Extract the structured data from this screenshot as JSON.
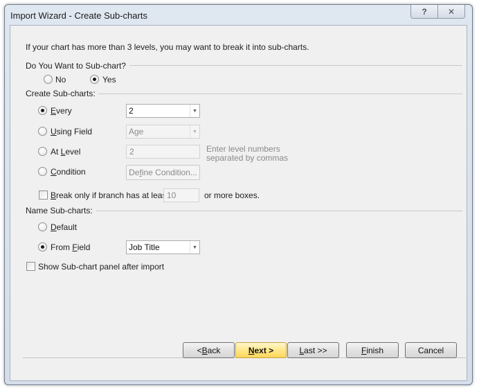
{
  "window": {
    "title": "Import Wizard - Create Sub-charts",
    "help_glyph": "?",
    "close_glyph": "✕"
  },
  "intro": "If your chart has more than 3 levels, you may want to break it into sub-charts.",
  "subchart_question": {
    "label": "Do You Want to Sub-chart?",
    "options": [
      {
        "label": "No",
        "checked": false
      },
      {
        "label": "Yes",
        "checked": true
      }
    ]
  },
  "create_subcharts": {
    "label": "Create Sub-charts:",
    "every": {
      "label": "Every",
      "accel": "E",
      "rest": "very",
      "checked": true,
      "value": "2"
    },
    "using_field": {
      "label": "Using Field",
      "accel": "U",
      "rest": "sing Field",
      "checked": false,
      "value": "Age"
    },
    "at_level": {
      "label": "At Level",
      "pre": "At ",
      "accel": "L",
      "rest": "evel",
      "checked": false,
      "value": "2",
      "hint_line1": "Enter level numbers",
      "hint_line2": "separated by commas"
    },
    "condition": {
      "label": "Condition",
      "accel": "C",
      "rest": "ondition",
      "checked": false,
      "button_label": "Define Condition...",
      "button_pre": "De",
      "button_accel": "f",
      "button_rest": "ine Condition..."
    },
    "break_only": {
      "label": "Break only if branch has at least",
      "accel": "B",
      "rest": "reak only if branch has at least",
      "checked": false,
      "value": "10",
      "suffix": "or more boxes."
    }
  },
  "name_subcharts": {
    "label": "Name Sub-charts:",
    "default": {
      "label": "Default",
      "accel": "D",
      "rest": "efault",
      "checked": false
    },
    "from_field": {
      "label": "From Field",
      "pre": "From ",
      "accel": "F",
      "rest": "ield",
      "checked": true,
      "value": "Job Title"
    }
  },
  "show_panel": {
    "label": "Show Sub-chart panel after import",
    "checked": false
  },
  "footer": {
    "back": {
      "label": "< Back",
      "pre": "< ",
      "accel": "B",
      "rest": "ack"
    },
    "next": {
      "label": "Next >",
      "accel": "N",
      "rest": "ext >"
    },
    "last": {
      "label": "Last >>",
      "accel": "L",
      "rest": "ast >>"
    },
    "finish": {
      "label": "Finish",
      "accel": "F",
      "rest": "inish"
    },
    "cancel": {
      "label": "Cancel"
    }
  }
}
